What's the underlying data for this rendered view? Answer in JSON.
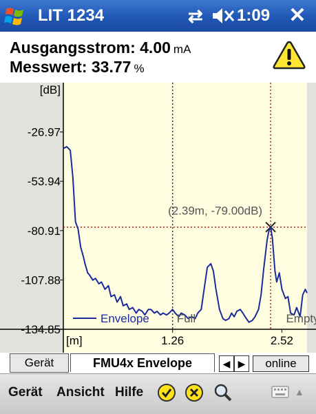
{
  "titlebar": {
    "app_title": "LIT 1234",
    "time": "1:09",
    "close_label": "✕",
    "sync_icon": "⇄"
  },
  "header": {
    "line1_label": "Ausgangsstrom: 4.00",
    "line1_unit": "mA",
    "line2_label": "Messwert: 33.77",
    "line2_unit": "%"
  },
  "chart_data": {
    "type": "line",
    "ylabel": "[dB]",
    "xlabel": "[m]",
    "y_ticks": [
      "-26.97",
      "-53.94",
      "-80.91",
      "-107.88",
      "-134.85"
    ],
    "x_ticks": [
      "1.26",
      "2.52"
    ],
    "xlim": [
      0,
      2.81
    ],
    "ylim": [
      -134.85,
      0
    ],
    "series": [
      {
        "name": "Envelope",
        "color": "#1b2a9b",
        "x": [
          0.0,
          0.04,
          0.08,
          0.11,
          0.14,
          0.17,
          0.2,
          0.23,
          0.25,
          0.28,
          0.3,
          0.34,
          0.37,
          0.41,
          0.44,
          0.48,
          0.52,
          0.55,
          0.59,
          0.62,
          0.66,
          0.69,
          0.73,
          0.76,
          0.8,
          0.84,
          0.87,
          0.91,
          0.94,
          0.98,
          1.01,
          1.05,
          1.08,
          1.12,
          1.15,
          1.19,
          1.22,
          1.26,
          1.29,
          1.33,
          1.36,
          1.4,
          1.44,
          1.48,
          1.52,
          1.55,
          1.59,
          1.62,
          1.66,
          1.7,
          1.73,
          1.76,
          1.8,
          1.84,
          1.87,
          1.91,
          1.94,
          1.97,
          2.0,
          2.04,
          2.07,
          2.11,
          2.14,
          2.18,
          2.21,
          2.25,
          2.28,
          2.31,
          2.35,
          2.37,
          2.39,
          2.41,
          2.44,
          2.46,
          2.49,
          2.52,
          2.56,
          2.59,
          2.62,
          2.66,
          2.69,
          2.73,
          2.76,
          2.79,
          2.81
        ],
        "values": [
          -36,
          -35,
          -37,
          -52,
          -76,
          -80,
          -90,
          -95,
          -99,
          -104,
          -105,
          -108,
          -107,
          -110,
          -109,
          -113,
          -111,
          -117,
          -116,
          -120,
          -117,
          -122,
          -121,
          -124,
          -123,
          -126,
          -124,
          -125,
          -127,
          -124,
          -124,
          -126,
          -125,
          -127,
          -126,
          -127,
          -126,
          -124,
          -126,
          -128,
          -126,
          -127,
          -129,
          -128,
          -129,
          -126,
          -124,
          -114,
          -101,
          -99,
          -103,
          -113,
          -124,
          -129,
          -130,
          -129,
          -126,
          -128,
          -125,
          -124,
          -126,
          -129,
          -131,
          -130,
          -128,
          -124,
          -116,
          -102,
          -86,
          -81,
          -79,
          -85,
          -103,
          -109,
          -104,
          -113,
          -118,
          -117,
          -126,
          -127,
          -123,
          -128,
          -116,
          -113,
          -115
        ]
      }
    ],
    "annotations": [
      {
        "label": "(2.39m, -79.00dB)",
        "x": 2.39,
        "y": -79.0
      },
      {
        "label": "Full",
        "x": 1.26
      },
      {
        "label": "Empty",
        "x": 2.52
      }
    ],
    "legend": "bottom-left",
    "cursor": {
      "x": 2.39,
      "y": -79.0
    }
  },
  "tabs": {
    "tab1": "Gerät",
    "tab2": "FMU4x Envelope",
    "online": "online",
    "prev": "◀",
    "next": "▶"
  },
  "menu": {
    "item1": "Gerät",
    "item2": "Ansicht",
    "item3": "Hilfe"
  }
}
